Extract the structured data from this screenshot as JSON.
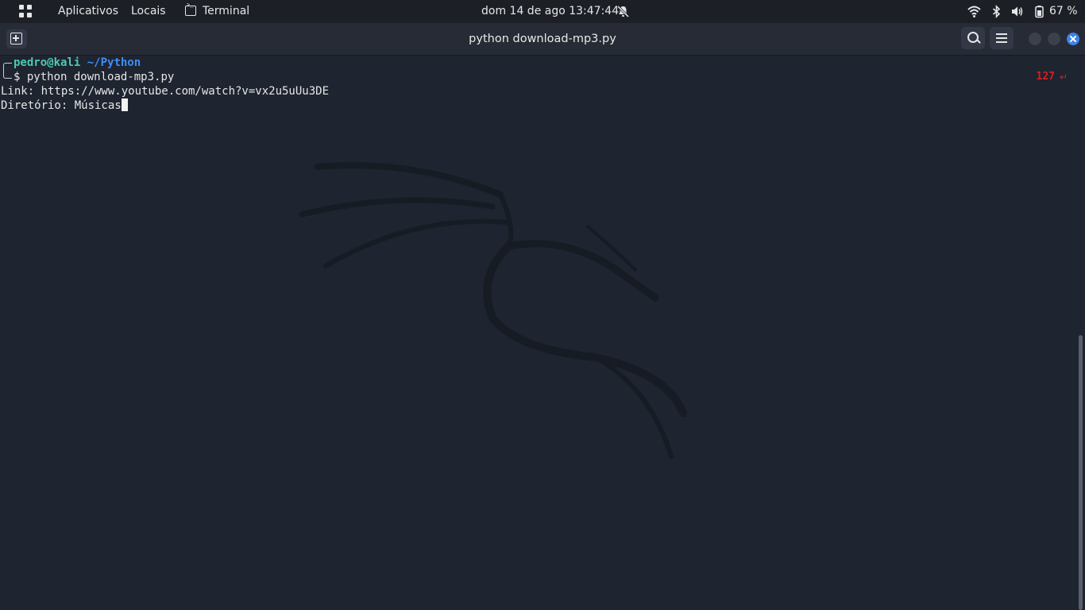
{
  "topbar": {
    "apps_label": "Aplicativos",
    "places_label": "Locais",
    "active_app_label": "Terminal",
    "datetime": "dom 14 de ago  13:47:44",
    "battery_percent": "67 %",
    "icons": [
      "apps-grid-icon",
      "terminal-icon",
      "notifications-off-icon",
      "wifi-icon",
      "bluetooth-icon",
      "volume-icon",
      "battery-icon"
    ]
  },
  "window": {
    "title": "python download-mp3.py",
    "buttons": [
      "new-tab",
      "search",
      "menu",
      "minimize",
      "maximize",
      "close"
    ]
  },
  "terminal": {
    "prompt_user": "pedro@kali",
    "prompt_path": "~/Python",
    "prompt_symbol": "$",
    "command": "python download-mp3.py",
    "exit_code": "127",
    "exit_symbol": "↵",
    "output_lines": [
      "Link: https://www.youtube.com/watch?v=vx2u5uUu3DE",
      "Diretório: Músicas"
    ]
  },
  "colors": {
    "background": "#1e2430",
    "prompt_user": "#4ec9b0",
    "prompt_path": "#3f8ef5",
    "exit_code": "#e01b1b",
    "close_button": "#3d82e8"
  }
}
